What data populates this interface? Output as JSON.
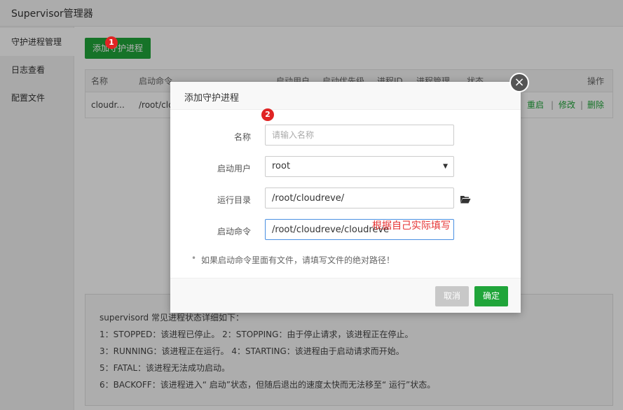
{
  "app": {
    "title": "Supervisor管理器"
  },
  "sidebar": {
    "items": [
      {
        "label": "守护进程管理"
      },
      {
        "label": "日志查看"
      },
      {
        "label": "配置文件"
      }
    ]
  },
  "toolbar": {
    "add_label": "添加守护进程"
  },
  "badges": {
    "one": "1",
    "two": "2"
  },
  "table": {
    "headers": [
      "名称",
      "启动命令",
      "启动用户",
      "启动优先级",
      "进程ID",
      "进程管理",
      "状态",
      "操作"
    ],
    "row": {
      "name": "cloudr...",
      "command": "/root/cloudreve/cloudreve"
    },
    "ops": [
      "重启",
      "修改",
      "删除"
    ],
    "sep": "|"
  },
  "info": {
    "lines": [
      "supervisord 常见进程状态详细如下：",
      "1：STOPPED：该进程已停止。     2：STOPPING：由于停止请求，该进程正在停止。",
      "3：RUNNING：该进程正在运行。  4：STARTING：该进程由于启动请求而开始。",
      "5：FATAL：该进程无法成功启动。",
      "6：BACKOFF：该进程进入“ 启动”状态，但随后退出的速度太快而无法移至“ 运行”状态。"
    ]
  },
  "dialog": {
    "title": "添加守护进程",
    "close": "×",
    "fields": {
      "name": {
        "label": "名称",
        "value": "",
        "placeholder": "请输入名称"
      },
      "user": {
        "label": "启动用户",
        "value": "root"
      },
      "dir": {
        "label": "运行目录",
        "value": "/root/cloudreve/"
      },
      "command": {
        "label": "启动命令",
        "value": "/root/cloudreve/cloudreve"
      }
    },
    "annotation": "根据自己实际填写",
    "tip": "如果启动命令里面有文件，请填写文件的绝对路径！",
    "cancel": "取消",
    "confirm": "确定"
  },
  "colors": {
    "accent": "#20a53a",
    "badge": "#e02424",
    "annotation": "#e53333"
  }
}
